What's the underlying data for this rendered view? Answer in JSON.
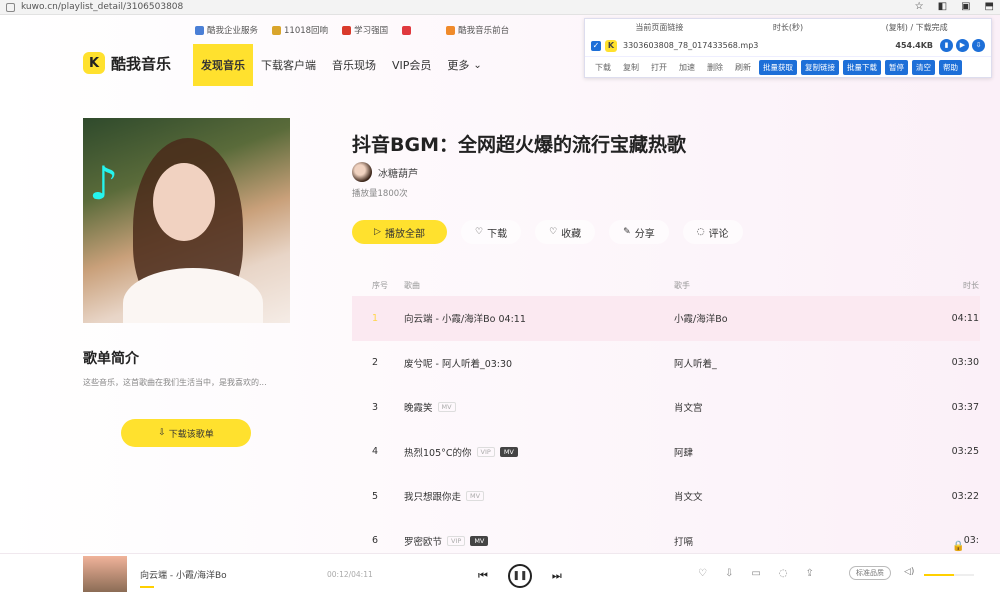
{
  "browser": {
    "url": "kuwo.cn/playlist_detail/3106503808"
  },
  "top_links": [
    {
      "label": "酷我企业服务",
      "color": "#4a7fd6"
    },
    {
      "label": "11018回响",
      "color": "#d9a52b"
    },
    {
      "label": "学习强国",
      "color": "#d93a2b"
    },
    {
      "label": "",
      "color": "#e0393e"
    },
    {
      "label": "酷我音乐前台",
      "color": "#f08a2a"
    }
  ],
  "header": {
    "logo_mark": "K",
    "logo_text": "酷我音乐",
    "nav": [
      "发现音乐",
      "下载客户端",
      "音乐现场",
      "VIP会员",
      "更多"
    ]
  },
  "download_panel": {
    "head": [
      "当前页面链接",
      "时长(秒)",
      "(复制) / 下载完成"
    ],
    "file_name": "3303603808_78_017433568.mp3",
    "size": "454.4KB",
    "actions_text": [
      "下载",
      "复制",
      "打开",
      "加速",
      "删除",
      "刷新"
    ],
    "actions_btn": [
      "批量获取",
      "复制链接",
      "批量下载",
      "暂停",
      "清空",
      "帮助"
    ]
  },
  "playlist": {
    "title": "抖音BGM：全网超火爆的流行宝藏热歌",
    "author": "冰糖葫芦",
    "plays": "播放量1800次",
    "buttons": {
      "play_all": "播放全部",
      "download": "下载",
      "collect": "收藏",
      "share": "分享",
      "comment": "评论"
    }
  },
  "intro": {
    "title": "歌单简介",
    "text": "这些音乐，这首歌曲在我们生活当中，是我喜欢的..."
  },
  "download_list_button": "下载该歌单",
  "table": {
    "headers": {
      "num": "序号",
      "song": "歌曲",
      "artist": "歌手",
      "duration": "时长"
    },
    "rows": [
      {
        "num": "1",
        "song": "向云端 - 小霞/海洋Bo 04:11",
        "artist": "小霞/海洋Bo",
        "duration": "04:11",
        "tags": []
      },
      {
        "num": "2",
        "song": "废兮呢 - 阿人听着_03:30",
        "artist": "阿人听着_",
        "duration": "03:30",
        "tags": []
      },
      {
        "num": "3",
        "song": "晚霞笑",
        "artist": "肖文宫",
        "duration": "03:37",
        "tags": [
          "MV"
        ]
      },
      {
        "num": "4",
        "song": "热烈105°C的你",
        "artist": "阿肆",
        "duration": "03:25",
        "tags": [
          "VIP",
          "MV"
        ]
      },
      {
        "num": "5",
        "song": "我只想跟你走",
        "artist": "肖文文",
        "duration": "03:22",
        "tags": [
          "MV"
        ]
      },
      {
        "num": "6",
        "song": "罗密欧节",
        "artist": "打嗝",
        "duration": "03:",
        "tags": [
          "VIP",
          "MV"
        ]
      }
    ]
  },
  "player": {
    "song": "向云端 - 小霞/海洋Bo",
    "time": "00:12/04:11",
    "quality": "标准品质",
    "volume_fraction": 0.6
  },
  "colors": {
    "brand_yellow": "#ffe12e",
    "accent_blue": "#1d6fd8",
    "highlight_row": "#fbe9f1"
  }
}
